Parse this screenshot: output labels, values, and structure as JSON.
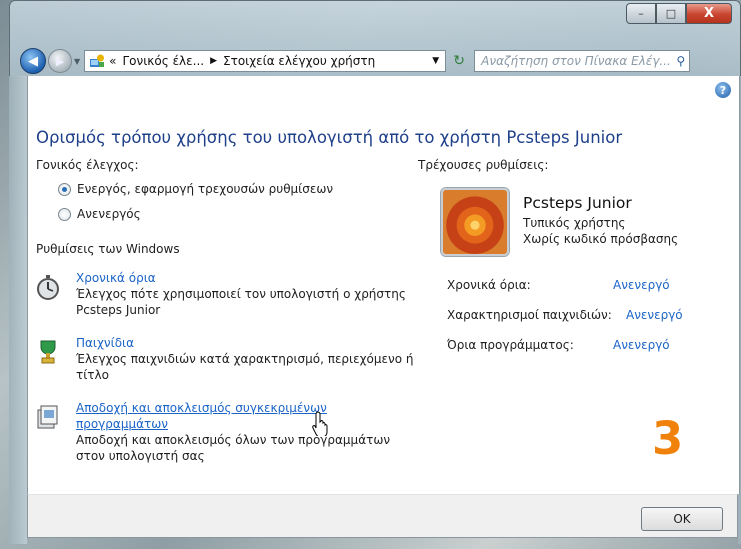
{
  "window": {
    "controls": {
      "minimize": "–",
      "maximize": "□",
      "close": "X"
    }
  },
  "address_bar": {
    "overflow": "«",
    "crumb1": "Γονικός έλε...",
    "crumb2": "Στοιχεία ελέγχου χρήστη",
    "search_placeholder": "Αναζήτηση στον Πίνακα Ελέγ..."
  },
  "page": {
    "title": "Ορισμός τρόπου χρήσης του υπολογιστή από το χρήστη Pcsteps Junior",
    "parental_label": "Γονικός έλεγχος:",
    "radio_on": "Ενεργός, εφαρμογή τρεχουσών ρυθμίσεων",
    "radio_off": "Ανενεργός",
    "radio_selected": "on",
    "windows_settings_label": "Ρυθμίσεις των Windows",
    "settings": [
      {
        "icon": "stopwatch-icon",
        "link": "Χρονικά όρια",
        "desc": "Έλεγχος πότε χρησιμοποιεί τον υπολογιστή ο χρήστης Pcsteps Junior"
      },
      {
        "icon": "trophy-icon",
        "link": "Παιχνίδια",
        "desc": "Έλεγχος παιχνιδιών κατά χαρακτηρισμό, περιεχόμενο ή τίτλο"
      },
      {
        "icon": "programs-icon",
        "link": "Αποδοχή και αποκλεισμός συγκεκριμένων προγραμμάτων",
        "desc": "Αποδοχή και αποκλεισμός όλων των προγραμμάτων στον υπολογιστή σας"
      }
    ],
    "current_label": "Τρέχουσες ρυθμίσεις:",
    "user_name": "Pcsteps Junior",
    "user_type": "Τυπικός χρήστης",
    "user_password": "Χωρίς κωδικό πρόσβασης",
    "status": [
      {
        "label": "Χρονικά όρια:",
        "value": "Ανενεργό"
      },
      {
        "label": "Χαρακτηρισμοί παιχνιδιών:",
        "value": "Ανενεργό"
      },
      {
        "label": "Όρια προγράμματος:",
        "value": "Ανενεργό"
      }
    ],
    "step_number": "3"
  },
  "footer": {
    "ok_label": "OK"
  },
  "colors": {
    "accent_link": "#1b64c7",
    "title": "#1e3f8a",
    "step": "#f0820c"
  }
}
